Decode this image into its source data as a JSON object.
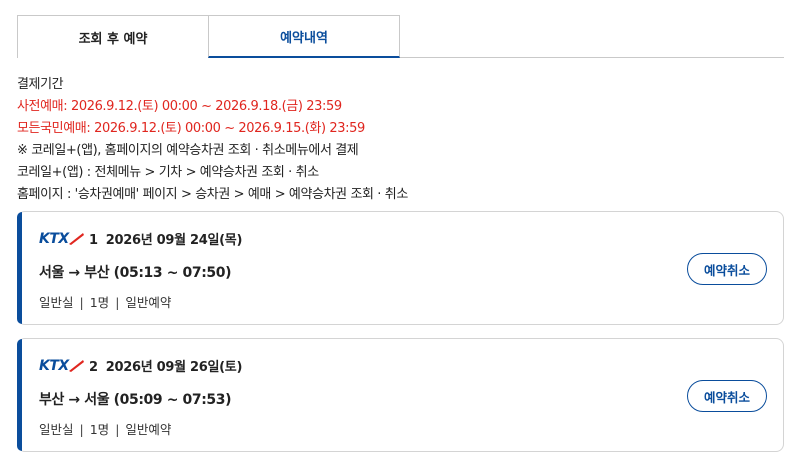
{
  "tabs": [
    {
      "label": "조회 후 예약"
    },
    {
      "label": "예약내역"
    }
  ],
  "info": {
    "title": "결제기간",
    "lines": [
      "사전예매: 2026.9.12.(토) 00:00 ~ 2026.9.18.(금) 23:59",
      "모든국민예매: 2026.9.12.(토) 00:00 ~ 2026.9.15.(화) 23:59",
      "※ 코레일+(앱), 홈페이지의 예약승차권 조회 · 취소메뉴에서 결제",
      "코레일+(앱) : 전체메뉴 > 기차 > 예약승차권 조회 · 취소",
      "홈페이지 : '승차권예매' 페이지 > 승차권 > 예매 > 예약승차권 조회 · 취소"
    ]
  },
  "colors": {
    "accent": "#0a4d9c",
    "warning": "#e0261f"
  },
  "reservations": [
    {
      "logo": "KTX",
      "index": "1",
      "date": "2026년 09월 24일(목)",
      "route": "서울 → 부산 (05:13 ~ 07:50)",
      "seat_class": "일반실",
      "count": "1명",
      "type": "일반예약",
      "cancel_label": "예약취소"
    },
    {
      "logo": "KTX",
      "index": "2",
      "date": "2026년 09월 26일(토)",
      "route": "부산 → 서울 (05:09 ~ 07:53)",
      "seat_class": "일반실",
      "count": "1명",
      "type": "일반예약",
      "cancel_label": "예약취소"
    }
  ]
}
